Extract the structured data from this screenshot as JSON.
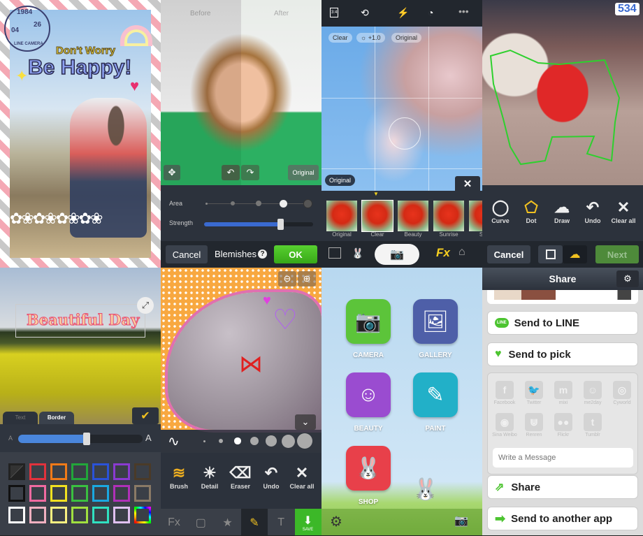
{
  "panel_stamp": {
    "stamp_year": "1984",
    "stamp_month": "04",
    "stamp_day": "26",
    "stamp_brand": "LINE CAMERA",
    "sticker_line1": "Don't Worry",
    "sticker_line2": "Be Happy!"
  },
  "panel_blemish": {
    "before_label": "Before",
    "after_label": "After",
    "original_button": "Original",
    "area_label": "Area",
    "strength_label": "Strength",
    "strength_percent": 70,
    "area_level": 4,
    "area_levels": 5,
    "cancel_button": "Cancel",
    "mode_label": "Blemishes",
    "help_icon": "?",
    "ok_button": "OK",
    "icons": [
      "move-icon",
      "undo-icon",
      "redo-icon"
    ]
  },
  "panel_camera": {
    "ratio_label": "3:4",
    "chip_clear": "Clear",
    "chip_exposure": "+1.0",
    "chip_original": "Original",
    "original_badge": "Original",
    "close_icon": "✕",
    "filters": [
      "Original",
      "Clear",
      "Beauty",
      "Sunrise",
      "Sun"
    ],
    "selected_filter": "Clear",
    "icons": [
      "aspect-ratio-icon",
      "switch-camera-icon",
      "flash-auto-icon",
      "timer-icon",
      "more-icon",
      "gallery-icon",
      "sticker-icon",
      "shutter-icon",
      "fx-icon",
      "home-icon"
    ],
    "fx_label": "Fx"
  },
  "panel_cutout": {
    "tools": [
      "Curve",
      "Dot",
      "Draw",
      "Undo",
      "Clear all"
    ],
    "selected_tool": "Dot",
    "cancel_button": "Cancel",
    "next_button": "Next",
    "corner_label": "534"
  },
  "panel_text": {
    "sticker_text": "Beautiful Day",
    "tabs": [
      "Text",
      "Border"
    ],
    "active_tab": "Border",
    "border_width_percent": 55,
    "swatch_colors": [
      "none",
      "#e0323c",
      "#f07a18",
      "#22a63a",
      "#2a52d8",
      "#8a3ad0",
      "#4a3a28",
      "#111111",
      "#f06aa0",
      "#f0e020",
      "#3ac040",
      "#1aa8e0",
      "#b030b8",
      "#8a7a66",
      "#ffffff",
      "#f0b0c0",
      "#f8f080",
      "#a0e040",
      "#30e0c0",
      "#e0c0f0",
      "rainbow"
    ]
  },
  "panel_brush": {
    "tools": [
      "Brush",
      "Detail",
      "Eraser",
      "Undo",
      "Clear all"
    ],
    "selected_tool": "Brush",
    "save_label": "SAVE",
    "bottom_tabs": [
      "fx-icon",
      "frame-icon",
      "star-icon",
      "brush-icon",
      "text-icon",
      "save-icon"
    ],
    "brush_sizes": 7,
    "selected_size": 3
  },
  "panel_home": {
    "apps": [
      {
        "label": "CAMERA",
        "color": "#5cc43a",
        "icon": "📷"
      },
      {
        "label": "GALLERY",
        "color": "#4e5fa8",
        "icon": "🖼"
      },
      {
        "label": "BEAUTY",
        "color": "#9a4cd0",
        "icon": "☺"
      },
      {
        "label": "PAINT",
        "color": "#22b0c8",
        "icon": "✎"
      },
      {
        "label": "SHOP",
        "color": "#e8404a",
        "icon": "🐰"
      }
    ]
  },
  "panel_share": {
    "title": "Share",
    "send_line": "Send to LINE",
    "line_badge": "LINE",
    "send_pick": "Send to pick",
    "services": [
      "Facebook",
      "Twitter",
      "mixi",
      "me2day",
      "Cyworld",
      "Sina Weibo",
      "Renren",
      "Flickr",
      "Tumblr"
    ],
    "service_glyphs": [
      "f",
      "🐦",
      "m",
      "☺",
      "◎",
      "◉",
      "⋓",
      "●●",
      "t"
    ],
    "message_placeholder": "Write a Message",
    "share": "Share",
    "send_other": "Send to another app"
  }
}
